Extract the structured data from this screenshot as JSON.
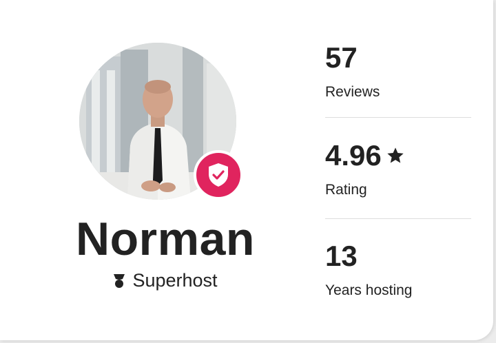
{
  "profile": {
    "name": "Norman",
    "badge": "Superhost",
    "badge_icon": "superhost-ribbon-icon",
    "verified_icon": "verified-shield-icon",
    "accent_color": "#e0245e"
  },
  "stats": [
    {
      "value": "57",
      "label": "Reviews"
    },
    {
      "value": "4.96",
      "label": "Rating",
      "icon": "star-icon"
    },
    {
      "value": "13",
      "label": "Years hosting"
    }
  ]
}
